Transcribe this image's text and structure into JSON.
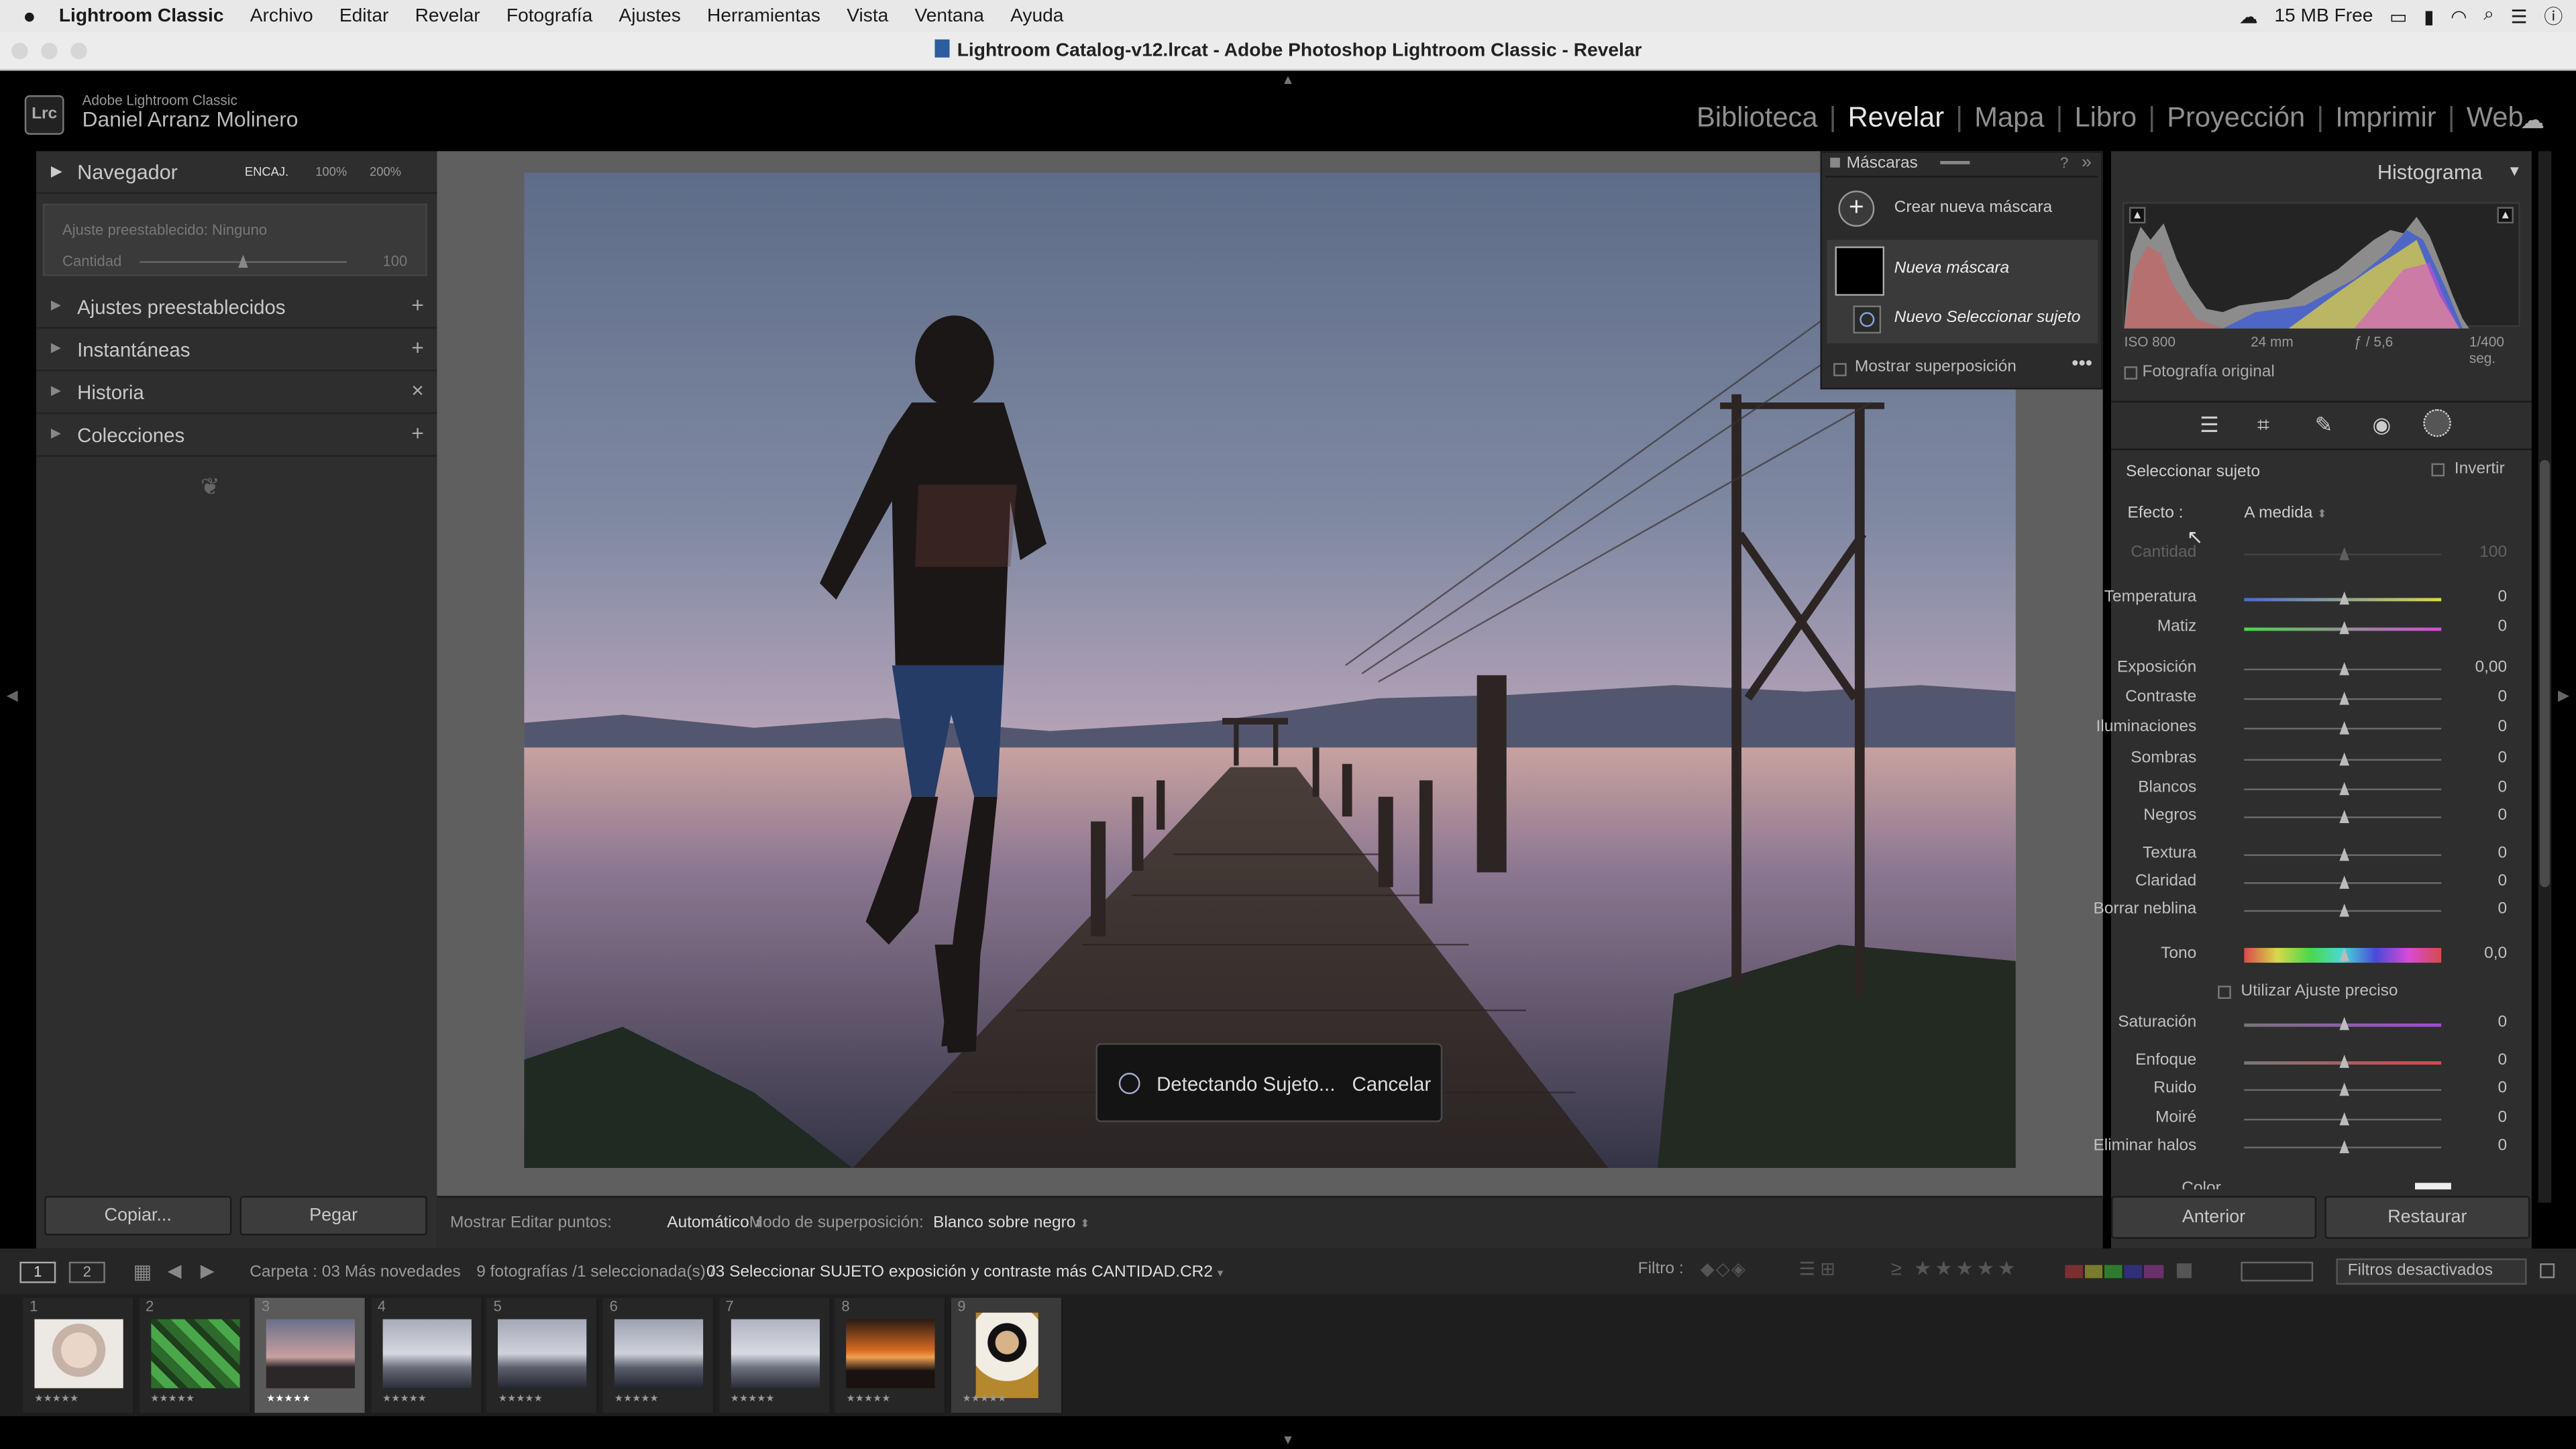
{
  "menubar": {
    "app": "Lightroom Classic",
    "items": [
      "Archivo",
      "Editar",
      "Revelar",
      "Fotografía",
      "Ajustes",
      "Herramientas",
      "Vista",
      "Ventana",
      "Ayuda"
    ],
    "free": "15 MB Free"
  },
  "window_title": "Lightroom Catalog-v12.lrcat - Adobe Photoshop Lightroom Classic - Revelar",
  "identity": {
    "logo": "Lrc",
    "product": "Adobe Lightroom Classic",
    "user": "Daniel Arranz Molinero"
  },
  "modules": [
    {
      "label": "Biblioteca",
      "active": false
    },
    {
      "label": "Revelar",
      "active": true
    },
    {
      "label": "Mapa",
      "active": false
    },
    {
      "label": "Libro",
      "active": false
    },
    {
      "label": "Proyección",
      "active": false
    },
    {
      "label": "Imprimir",
      "active": false
    },
    {
      "label": "Web",
      "active": false
    }
  ],
  "left": {
    "navigator": {
      "title": "Navegador",
      "zoom_fit": "ENCAJ.",
      "z100": "100%",
      "z200": "200%"
    },
    "preset_box": {
      "label": "Ajuste preestablecido: Ninguno",
      "amount_label": "Cantidad",
      "amount_value": "100"
    },
    "sections": [
      {
        "label": "Ajustes preestablecidos",
        "action": "+"
      },
      {
        "label": "Instantáneas",
        "action": "+"
      },
      {
        "label": "Historia",
        "action": "×"
      },
      {
        "label": "Colecciones",
        "action": "+"
      }
    ],
    "copy_button": "Copiar...",
    "paste_button": "Pegar"
  },
  "masks": {
    "title": "Máscaras",
    "create": "Crear nueva máscara",
    "new_mask": "Nueva máscara",
    "new_subject": "Nuevo Seleccionar sujeto",
    "overlay": "Mostrar superposición"
  },
  "detecting": {
    "text": "Detectando Sujeto...",
    "cancel": "Cancelar"
  },
  "toolbar": {
    "edit_points_label": "Mostrar Editar puntos:",
    "edit_points_value": "Automático",
    "overlay_mode_label": "Modo de superposición:",
    "overlay_mode_value": "Blanco sobre negro"
  },
  "right": {
    "histogram": {
      "title": "Histograma",
      "iso": "ISO 800",
      "focal": "24 mm",
      "aperture": "ƒ / 5,6",
      "shutter": "1/400 seg.",
      "original": "Fotografía original"
    },
    "mask_section": {
      "title": "Seleccionar sujeto",
      "invert": "Invertir",
      "effect_label": "Efecto :",
      "effect_value": "A medida",
      "amount_label": "Cantidad",
      "amount_value": "100"
    },
    "sliders": [
      {
        "name": "Temperatura",
        "value": "0",
        "group": 1
      },
      {
        "name": "Matiz",
        "value": "0",
        "group": 1
      },
      {
        "name": "Exposición",
        "value": "0,00",
        "group": 2
      },
      {
        "name": "Contraste",
        "value": "0",
        "group": 2
      },
      {
        "name": "Iluminaciones",
        "value": "0",
        "group": 2
      },
      {
        "name": "Sombras",
        "value": "0",
        "group": 2
      },
      {
        "name": "Blancos",
        "value": "0",
        "group": 2
      },
      {
        "name": "Negros",
        "value": "0",
        "group": 2
      },
      {
        "name": "Textura",
        "value": "0",
        "group": 3
      },
      {
        "name": "Claridad",
        "value": "0",
        "group": 3
      },
      {
        "name": "Borrar neblina",
        "value": "0",
        "group": 3
      },
      {
        "name": "Tono",
        "value": "0,0",
        "group": 4
      },
      {
        "name": "Saturación",
        "value": "0",
        "group": 5
      },
      {
        "name": "Enfoque",
        "value": "0",
        "group": 6
      },
      {
        "name": "Ruido",
        "value": "0",
        "group": 6
      },
      {
        "name": "Moiré",
        "value": "0",
        "group": 6
      },
      {
        "name": "Eliminar halos",
        "value": "0",
        "group": 6
      }
    ],
    "fine_adjust": "Utilizar Ajuste preciso",
    "color_label": "Color",
    "prev_button": "Anterior",
    "reset_button": "Restaurar"
  },
  "filmbar": {
    "screen1": "1",
    "screen2": "2",
    "source": "Carpeta : 03 Más novedades",
    "info_prefix": "9 fotografías /1 seleccionada(s) /",
    "filename": "03 Seleccionar SUJETO exposición y contraste más CANTIDAD.CR2",
    "filter_label": "Filtro :",
    "filter_value": "Filtros desactivados"
  },
  "filmstrip": [
    {
      "n": "1",
      "selected": false,
      "stars": "★★★★★"
    },
    {
      "n": "2",
      "selected": false,
      "stars": "★★★★★"
    },
    {
      "n": "3",
      "selected": true,
      "stars": "★★★★★"
    },
    {
      "n": "4",
      "selected": false,
      "stars": "★★★★★"
    },
    {
      "n": "5",
      "selected": false,
      "stars": "★★★★★"
    },
    {
      "n": "6",
      "selected": false,
      "stars": "★★★★★"
    },
    {
      "n": "7",
      "selected": false,
      "stars": "★★★★★"
    },
    {
      "n": "8",
      "selected": false,
      "stars": "★★★★★"
    },
    {
      "n": "9",
      "selected": false,
      "stars": "★★★★★"
    }
  ]
}
